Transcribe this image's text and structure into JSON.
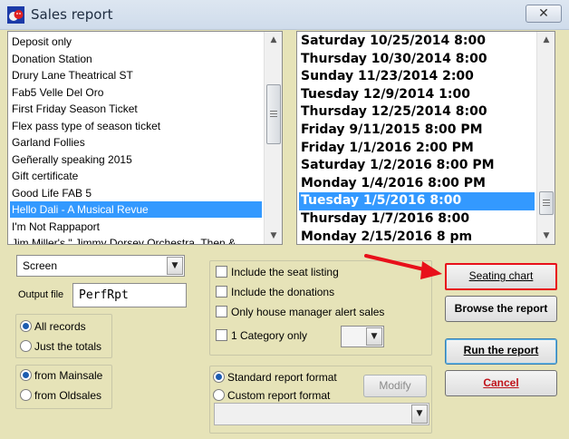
{
  "window": {
    "title": "Sales report",
    "close_glyph": "✕"
  },
  "show_list": {
    "items": [
      "Deposit only",
      "Donation Station",
      "Drury Lane Theatrical ST",
      "Fab5 Velle Del Oro",
      "First Friday Season Ticket",
      "Flex pass type of season ticket",
      "Garland Follies",
      "Geñerally speaking 2015",
      "Gift certificate",
      "Good Life FAB 5",
      "Hello Dali - A Musical Revue",
      "I'm Not Rappaport",
      "Jim Miller's \" Jimmy Dorsey Orchestra, Then &"
    ],
    "selected_index": 10
  },
  "date_list": {
    "items": [
      "Saturday  10/25/2014 8:00",
      "Thursday  10/30/2014 8:00",
      "Sunday   11/23/2014 2:00",
      "Tuesday  12/9/2014 1:00",
      "Thursday  12/25/2014 8:00",
      "Friday   9/11/2015 8:00 PM",
      "Friday   1/1/2016 2:00 PM",
      "Saturday  1/2/2016 8:00 PM",
      "Monday   1/4/2016 8:00 PM",
      "Tuesday  1/5/2016 8:00",
      "Thursday  1/7/2016 8:00",
      "Monday   2/15/2016 8 pm"
    ],
    "selected_index": 9
  },
  "output": {
    "destination": "Screen",
    "file_label": "Output file",
    "file_value": "PerfRpt"
  },
  "records": {
    "all": "All records",
    "totals": "Just the totals",
    "selected": "all"
  },
  "source": {
    "mainsale": "from Mainsale",
    "oldsales": "from Oldsales",
    "selected": "mainsale"
  },
  "options": {
    "seat_listing": "Include the seat listing",
    "donations": "Include the donations",
    "alert_sales": "Only house manager alert sales",
    "category": "1 Category only"
  },
  "format": {
    "standard": "Standard report format",
    "custom": "Custom report format",
    "selected": "standard",
    "modify": "Modify"
  },
  "buttons": {
    "seating_chart": "Seating chart",
    "browse": "Browse the report",
    "run": "Run the report",
    "cancel": "Cancel"
  },
  "colors": {
    "selection": "#3399ff",
    "annotation_red": "#e8101a",
    "background": "#e6e3b8"
  },
  "icons": {
    "app": "theatre-masks-icon",
    "dropdown": "chevron-down-icon",
    "close": "close-icon"
  }
}
